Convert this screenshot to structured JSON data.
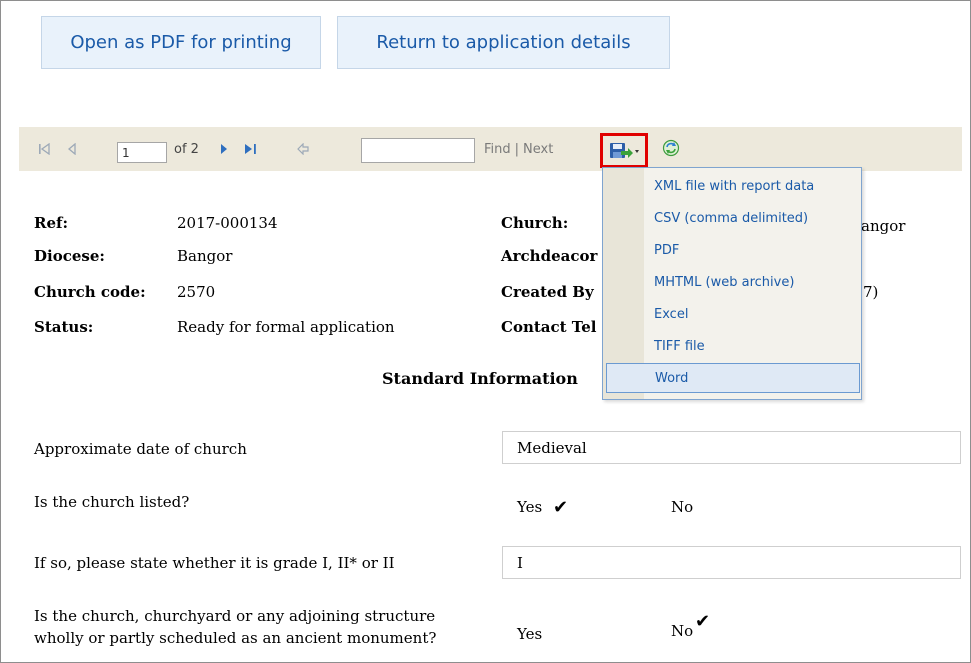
{
  "actions": {
    "open_pdf": "Open as PDF for printing",
    "return_details": "Return to application details"
  },
  "toolbar": {
    "page_value": "1",
    "page_of": "of 2",
    "find_label": "Find",
    "separator": "|",
    "next_label": "Next"
  },
  "export_menu": {
    "items": [
      "XML file with report data",
      "CSV (comma delimited)",
      "PDF",
      "MHTML (web archive)",
      "Excel",
      "TIFF file",
      "Word"
    ],
    "selected": "Word"
  },
  "info": {
    "ref_label": "Ref:",
    "ref_value": "2017-000134",
    "diocese_label": "Diocese:",
    "diocese_value": "Bangor",
    "church_code_label": "Church code:",
    "church_code_value": "2570",
    "status_label": "Status:",
    "status_value": "Ready for formal application",
    "church_label": "Church:",
    "church_value_visible": "angor",
    "archdeacon_label": "Archdeacor",
    "created_by_label": "Created By",
    "created_by_value_visible": "7)",
    "contact_label": "Contact Tel"
  },
  "section": {
    "title": "Standard Information"
  },
  "questions": {
    "q1": "Approximate date of church",
    "q1_answer": "Medieval",
    "q2": "Is the church listed?",
    "q2_yes": "Yes",
    "q2_no": "No",
    "q3": "If so, please state whether it is grade I, II* or II",
    "q3_answer": "I",
    "q4_line1": "Is the church, churchyard or any adjoining structure",
    "q4_line2": "wholly or partly scheduled as an ancient monument?",
    "q4_yes": "Yes",
    "q4_no": "No",
    "tick": "✔"
  },
  "icons": {
    "first_page": "first-page-icon",
    "prev_page": "previous-page-icon",
    "next_page": "next-page-icon",
    "last_page": "last-page-icon",
    "back": "back-icon",
    "export": "save-disk-icon",
    "refresh": "refresh-icon"
  },
  "colors": {
    "link_blue": "#1a5aa8",
    "highlight_red": "#e00000",
    "toolbar_bg": "#ede9dc"
  }
}
